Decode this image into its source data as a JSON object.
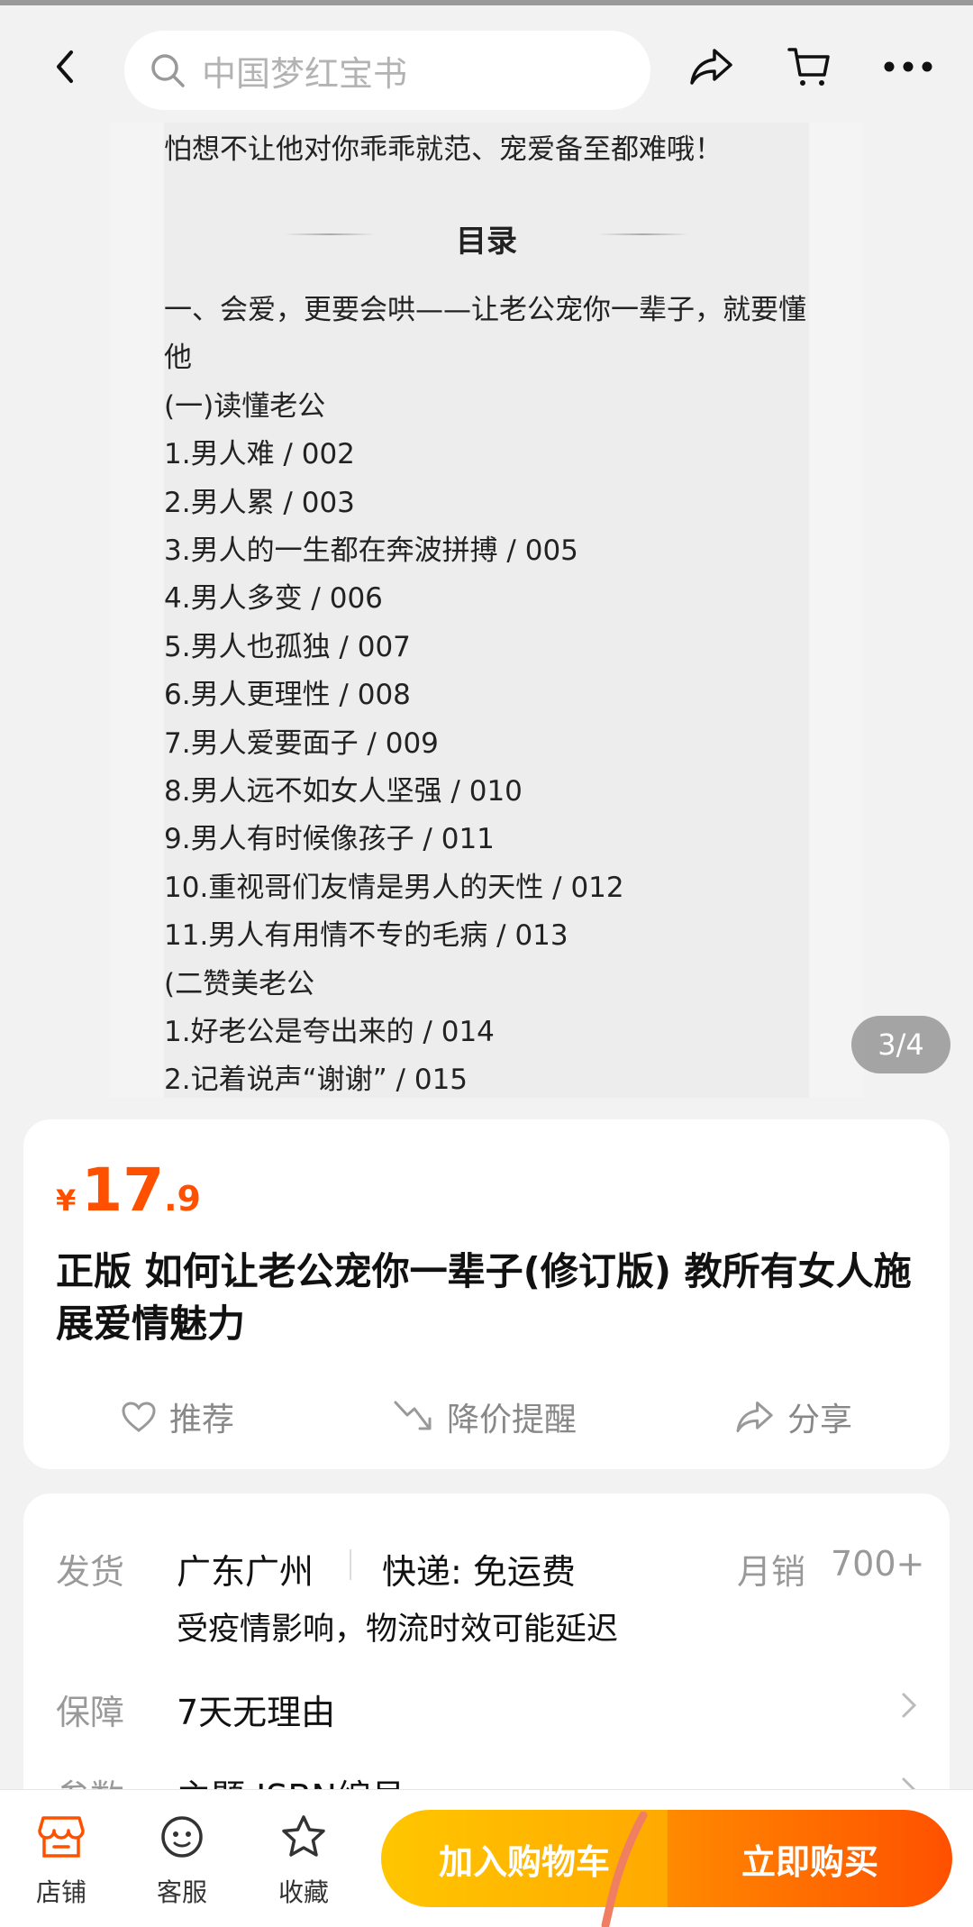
{
  "search": {
    "placeholder": "中国梦红宝书"
  },
  "gallery": {
    "counter": "3/4",
    "intro_line": "怕想不让他对你乖乖就范、宠爱备至都难哦！",
    "toc_title": "目录",
    "lines": [
      "一、会爱，更要会哄——让老公宠你一辈子，就要懂",
      "他",
      "(一)读懂老公",
      "1.男人难 / 002",
      "2.男人累 / 003",
      "3.男人的一生都在奔波拼搏 / 005",
      "4.男人多变 / 006",
      "5.男人也孤独 / 007",
      "6.男人更理性 / 008",
      "7.男人爱要面子 / 009",
      "8.男人远不如女人坚强 / 010",
      "9.男人有时候像孩子 / 011",
      "10.重视哥们友情是男人的天性 / 012",
      "11.男人有用情不专的毛病 / 013",
      "(二赞美老公",
      "1.好老公是夸出来的 / 014",
      "2.记着说声“谢谢” / 015"
    ]
  },
  "product": {
    "currency": "¥",
    "price_int": "17",
    "price_dec": ".9",
    "title": "正版 如何让老公宠你一辈子(修订版) 教所有女人施展爱情魅力",
    "actions": {
      "recommend": "推荐",
      "price_alert": "降价提醒",
      "share": "分享"
    }
  },
  "shipping": {
    "label": "发货",
    "origin": "广东广州",
    "express": "快递: 免运费",
    "monthly_label": "月销",
    "monthly_value": "700+",
    "notice": "受疫情影响，物流时效可能延迟"
  },
  "guarantee": {
    "label": "保障",
    "value": "7天无理由"
  },
  "params": {
    "label": "参数",
    "value": "主题 ISBN编号"
  },
  "bottom_bar": {
    "shop": "店铺",
    "service": "客服",
    "favorite": "收藏",
    "add_to_cart": "加入购物车",
    "buy_now": "立即购买"
  },
  "colors": {
    "accent": "#ff5000",
    "cart": "#ffb800",
    "buy": "#ff5a00"
  }
}
